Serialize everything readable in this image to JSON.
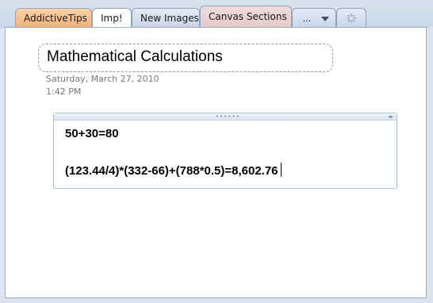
{
  "tabs": [
    {
      "label": "AddictiveTips"
    },
    {
      "label": "Imp!"
    },
    {
      "label": "New Images"
    },
    {
      "label": "Canvas Sections"
    },
    {
      "label": "..."
    }
  ],
  "page": {
    "title": "Mathematical Calculations",
    "date": "Saturday, March 27, 2010",
    "time": "1:42 PM"
  },
  "note": {
    "line1": "50+30=80",
    "line2": "(123.44/4)*(332-66)+(788*0.5)=8,602.76"
  },
  "colors": {
    "tab_addictive": "#f2b27a",
    "tab_canvas": "#e6c9c9",
    "chrome": "#dbe3ee",
    "note_border": "#a8bfd9"
  }
}
